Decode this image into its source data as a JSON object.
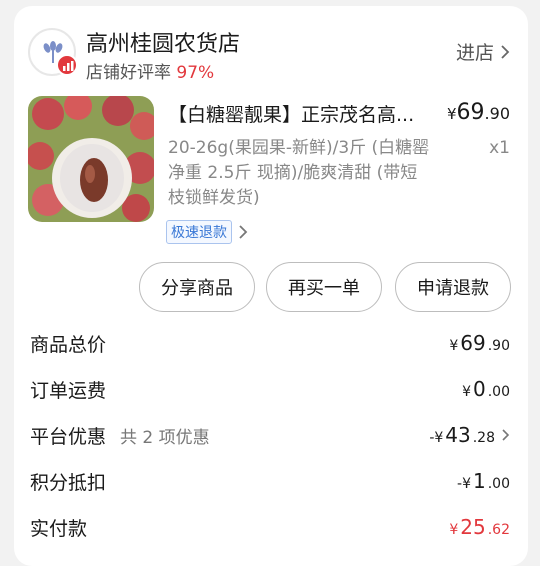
{
  "shop": {
    "name": "高州桂圆农货店",
    "rating_label": "店铺好评率",
    "rating_value": "97%",
    "enter_label": "进店"
  },
  "product": {
    "title": "【白糖罂靓果】正宗茂名高...",
    "price_symbol": "¥",
    "price_int": "69",
    "price_dec": ".90",
    "spec": "20-26g(果园果-新鲜)/3斤 (白糖罂净重 2.5斤  现摘)/脆爽清甜 (带短枝锁鲜发货)",
    "quantity": "x1",
    "refund_tag": "极速退款"
  },
  "actions": {
    "share": "分享商品",
    "rebuy": "再买一单",
    "refund": "申请退款"
  },
  "summary": {
    "goods_total": {
      "label": "商品总价",
      "prefix": "¥",
      "int": "69",
      "dec": ".90"
    },
    "shipping": {
      "label": "订单运费",
      "prefix": "¥",
      "int": "0",
      "dec": ".00"
    },
    "platform_discount": {
      "label": "平台优惠",
      "note": "共 2 项优惠",
      "prefix": "-¥",
      "int": "43",
      "dec": ".28"
    },
    "points": {
      "label": "积分抵扣",
      "prefix": "-¥",
      "int": "1",
      "dec": ".00"
    },
    "paid": {
      "label": "实付款",
      "prefix": "¥",
      "int": "25",
      "dec": ".62"
    }
  },
  "colors": {
    "accent_red": "#e2383d",
    "tag_blue": "#3a78d6"
  },
  "icons": {
    "logo": "wheat-logo-icon",
    "badge": "chart-badge-icon",
    "chevron": "chevron-right-icon"
  }
}
